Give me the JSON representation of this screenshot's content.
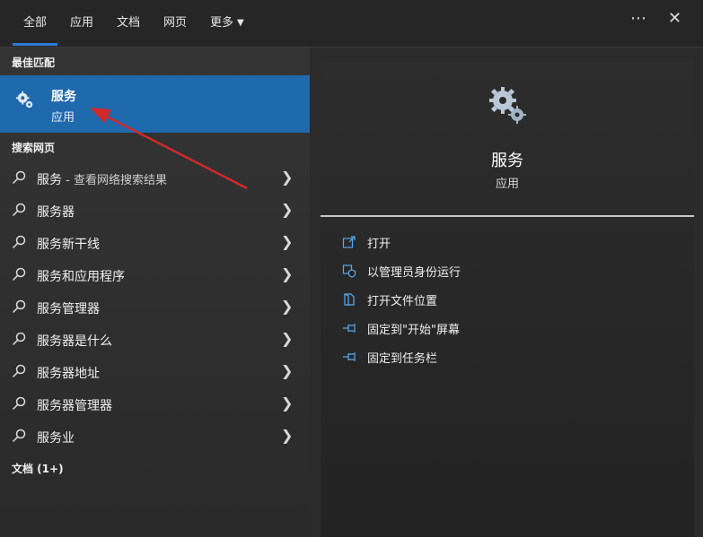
{
  "tabs": [
    "全部",
    "应用",
    "文档",
    "网页",
    "更多"
  ],
  "top_icons": {
    "more": "⋯",
    "close": "✕"
  },
  "left": {
    "best_match_title": "最佳匹配",
    "best": {
      "name": "服务",
      "type": "应用",
      "icon": "gear-icon"
    },
    "web_title": "搜索网页",
    "web_items": [
      {
        "label": "服务",
        "suffix": " - 查看网络搜索结果"
      },
      {
        "label": "服务器",
        "suffix": ""
      },
      {
        "label": "服务新干线",
        "suffix": ""
      },
      {
        "label": "服务和应用程序",
        "suffix": ""
      },
      {
        "label": "服务管理器",
        "suffix": ""
      },
      {
        "label": "服务器是什么",
        "suffix": ""
      },
      {
        "label": "服务器地址",
        "suffix": ""
      },
      {
        "label": "服务器管理器",
        "suffix": ""
      },
      {
        "label": "服务业",
        "suffix": ""
      }
    ],
    "docs_title": "文档 (1+)"
  },
  "right": {
    "title": "服务",
    "subtitle": "应用",
    "actions": [
      {
        "label": "打开",
        "icon": "open-icon"
      },
      {
        "label": "以管理员身份运行",
        "icon": "admin-shield-icon"
      },
      {
        "label": "打开文件位置",
        "icon": "file-location-icon"
      },
      {
        "label": "固定到\"开始\"屏幕",
        "icon": "pin-icon"
      },
      {
        "label": "固定到任务栏",
        "icon": "pin-icon"
      }
    ]
  },
  "colors": {
    "accent": "#1f69ad",
    "tab_underline": "#2d7ad6",
    "annotation_arrow": "#d22a2a"
  }
}
